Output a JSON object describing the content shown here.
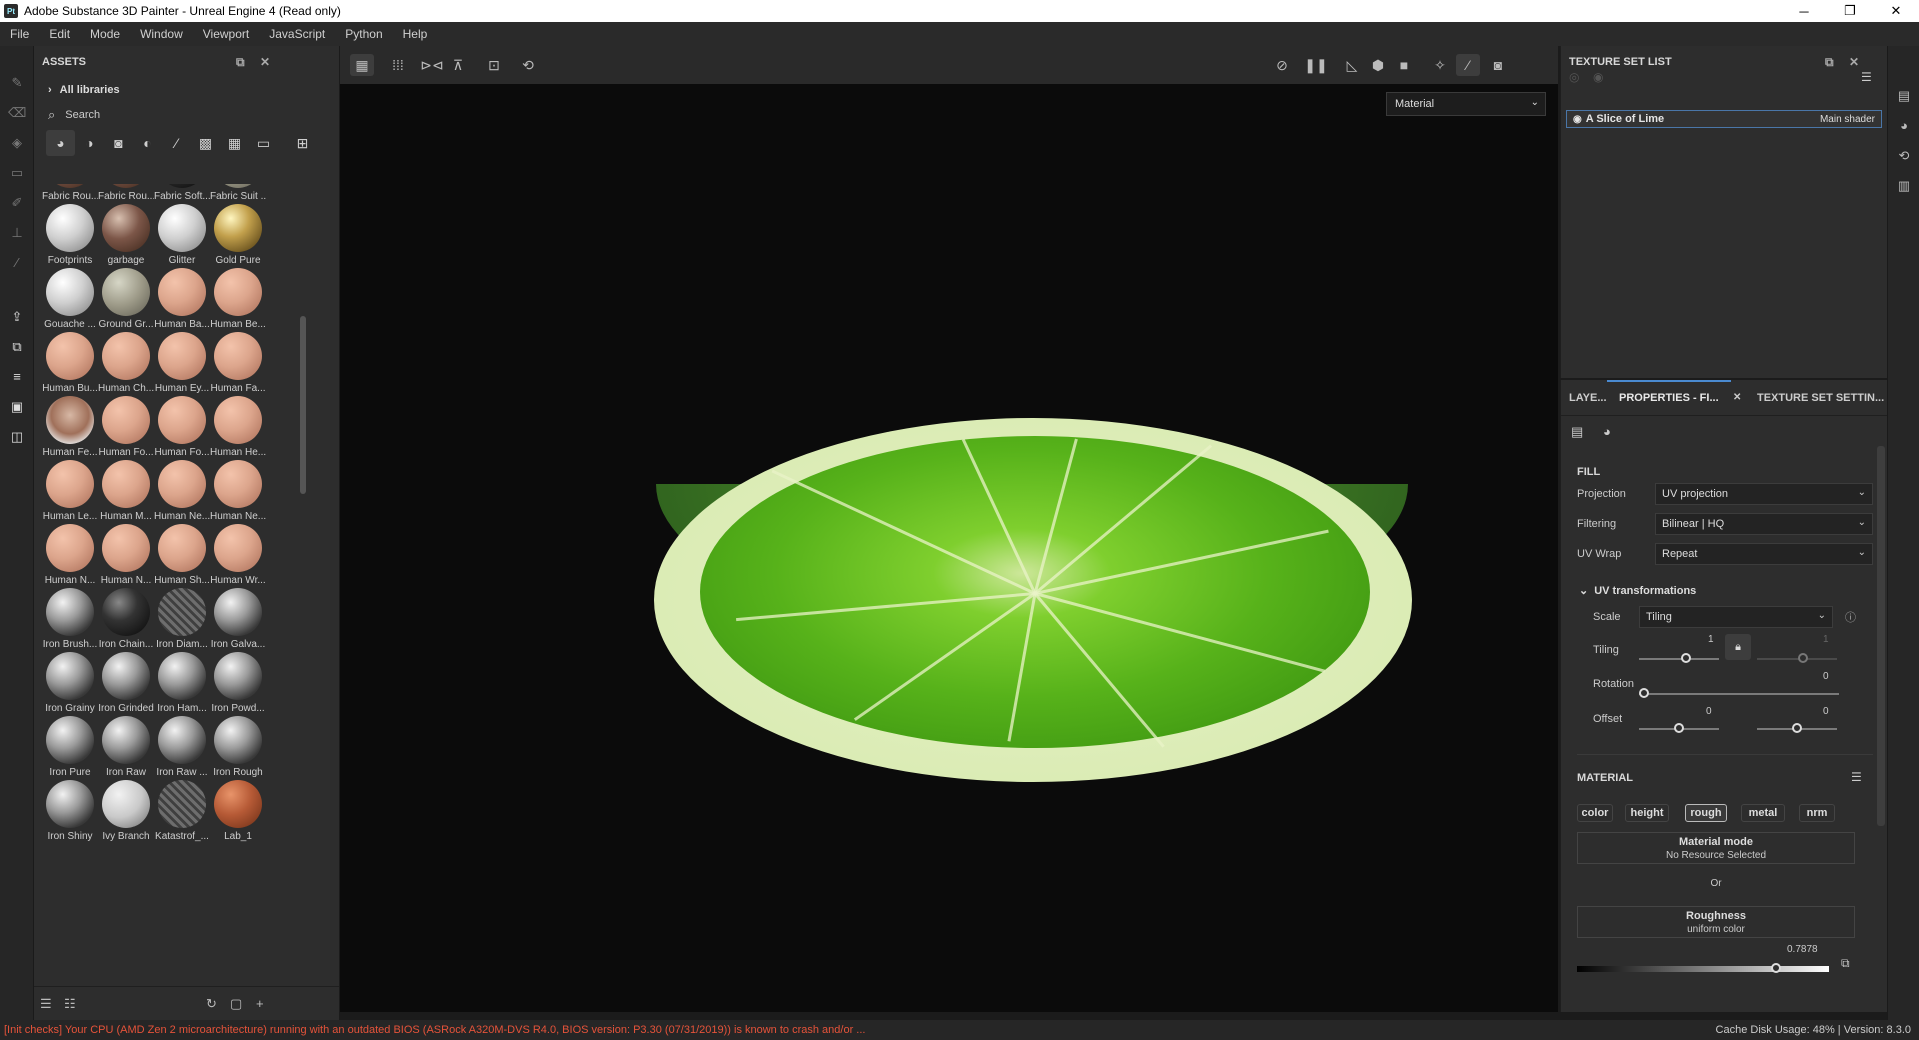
{
  "window": {
    "title": "Adobe Substance 3D Painter - Unreal Engine 4 (Read only)",
    "app_icon": "Pt",
    "min": "─",
    "max": "❐",
    "close": "✕"
  },
  "menu": [
    "File",
    "Edit",
    "Mode",
    "Window",
    "Viewport",
    "JavaScript",
    "Python",
    "Help"
  ],
  "assets": {
    "title": "ASSETS",
    "all_libraries": "All libraries",
    "search_placeholder": "Search",
    "items": [
      {
        "label": "Fabric Rou...",
        "style": "b-brown"
      },
      {
        "label": "Fabric Rou...",
        "style": "b-brown"
      },
      {
        "label": "Fabric Soft...",
        "style": "b-dark"
      },
      {
        "label": "Fabric Suit ...",
        "style": "b-gray"
      },
      {
        "label": "Footprints",
        "style": "b-white"
      },
      {
        "label": "garbage",
        "style": "b-brown"
      },
      {
        "label": "Glitter",
        "style": "b-white"
      },
      {
        "label": "Gold Pure",
        "style": "b-gold"
      },
      {
        "label": "Gouache ...",
        "style": "b-white"
      },
      {
        "label": "Ground Gr...",
        "style": "b-gray"
      },
      {
        "label": "Human Ba...",
        "style": "b-skin"
      },
      {
        "label": "Human Be...",
        "style": "b-skin"
      },
      {
        "label": "Human Bu...",
        "style": "b-skin"
      },
      {
        "label": "Human Ch...",
        "style": "b-skin"
      },
      {
        "label": "Human Ey...",
        "style": "b-skin"
      },
      {
        "label": "Human Fa...",
        "style": "b-skin"
      },
      {
        "label": "Human Fe...",
        "style": "b-face"
      },
      {
        "label": "Human Fo...",
        "style": "b-skin"
      },
      {
        "label": "Human Fo...",
        "style": "b-skin"
      },
      {
        "label": "Human He...",
        "style": "b-skin"
      },
      {
        "label": "Human Le...",
        "style": "b-skin"
      },
      {
        "label": "Human M...",
        "style": "b-skin"
      },
      {
        "label": "Human Ne...",
        "style": "b-skin"
      },
      {
        "label": "Human Ne...",
        "style": "b-skin"
      },
      {
        "label": "Human N...",
        "style": "b-skin"
      },
      {
        "label": "Human N...",
        "style": "b-skin"
      },
      {
        "label": "Human Sh...",
        "style": "b-skin"
      },
      {
        "label": "Human Wr...",
        "style": "b-skin"
      },
      {
        "label": "Iron Brush...",
        "style": "b-chrome"
      },
      {
        "label": "Iron Chain...",
        "style": "b-dark"
      },
      {
        "label": "Iron Diam...",
        "style": "b-pattern"
      },
      {
        "label": "Iron Galva...",
        "style": "b-chrome"
      },
      {
        "label": "Iron Grainy",
        "style": "b-chrome"
      },
      {
        "label": "Iron Grinded",
        "style": "b-chrome"
      },
      {
        "label": "Iron Ham...",
        "style": "b-chrome"
      },
      {
        "label": "Iron Powd...",
        "style": "b-chrome"
      },
      {
        "label": "Iron Pure",
        "style": "b-chrome"
      },
      {
        "label": "Iron Raw",
        "style": "b-chrome"
      },
      {
        "label": "Iron Raw ...",
        "style": "b-chrome"
      },
      {
        "label": "Iron Rough",
        "style": "b-chrome"
      },
      {
        "label": "Iron Shiny",
        "style": "b-chrome"
      },
      {
        "label": "Ivy Branch",
        "style": "b-ivy"
      },
      {
        "label": "Katastrof_...",
        "style": "b-pattern"
      },
      {
        "label": "Lab_1",
        "style": "b-brick"
      }
    ]
  },
  "viewport": {
    "material_select": "Material"
  },
  "texture_set_list": {
    "title": "TEXTURE SET LIST",
    "row_name": "A Slice of Lime",
    "row_shader": "Main shader"
  },
  "properties": {
    "tabs": [
      "LAYE...",
      "PROPERTIES - FI...",
      "TEXTURE SET SETTIN..."
    ],
    "fill_title": "FILL",
    "projection_label": "Projection",
    "projection_value": "UV projection",
    "filtering_label": "Filtering",
    "filtering_value": "Bilinear | HQ",
    "uvwrap_label": "UV Wrap",
    "uvwrap_value": "Repeat",
    "uvtrans_title": "UV transformations",
    "scale_label": "Scale",
    "scale_value": "Tiling",
    "tiling_label": "Tiling",
    "tiling_value": "1",
    "tiling_value2": "1",
    "rotation_label": "Rotation",
    "rotation_value": "0",
    "offset_label": "Offset",
    "offset_x": "0",
    "offset_y": "0",
    "material_title": "MATERIAL",
    "channels": [
      "color",
      "height",
      "rough",
      "metal",
      "nrm"
    ],
    "mat_mode_title": "Material mode",
    "mat_mode_sub": "No Resource Selected",
    "or": "Or",
    "rough_title": "Roughness",
    "rough_sub": "uniform color",
    "rough_value": "0.7878",
    "rough_level": 0.7878
  },
  "status": {
    "error": "[Init checks] Your CPU (AMD Zen 2 microarchitecture) running with an outdated BIOS (ASRock A320M-DVS R4.0, BIOS version: P3.30 (07/31/2019)) is known to crash and/or ...",
    "cache": "Cache Disk Usage:   48%  |  Version: 8.3.0"
  }
}
